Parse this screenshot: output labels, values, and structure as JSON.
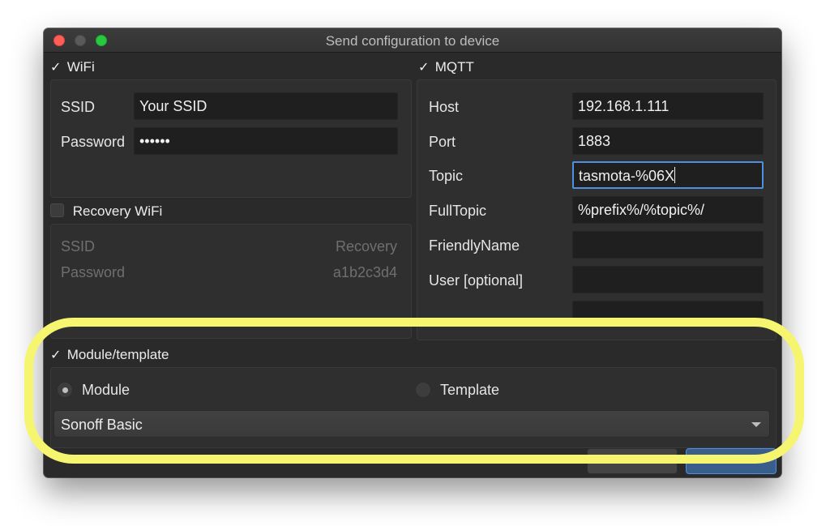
{
  "window": {
    "title": "Send configuration to device"
  },
  "wifi": {
    "header": "WiFi",
    "checked": true,
    "ssid_label": "SSID",
    "ssid_value": "Your SSID",
    "password_label": "Password",
    "password_value": "••••••"
  },
  "recovery_wifi": {
    "header": "Recovery WiFi",
    "checked": false,
    "ssid_label": "SSID",
    "ssid_value": "Recovery",
    "password_label": "Password",
    "password_value": "a1b2c3d4"
  },
  "mqtt": {
    "header": "MQTT",
    "checked": true,
    "host_label": "Host",
    "host_value": "192.168.1.111",
    "port_label": "Port",
    "port_value": "1883",
    "topic_label": "Topic",
    "topic_value": "tasmota-%06X",
    "fulltopic_label": "FullTopic",
    "fulltopic_value": "%prefix%/%topic%/",
    "friendlyname_label": "FriendlyName",
    "friendlyname_value": "",
    "user_label": "User [optional]",
    "user_value": ""
  },
  "module_template": {
    "header": "Module/template",
    "checked": true,
    "module_label": "Module",
    "template_label": "Template",
    "selected": "Module",
    "module_combo_value": "Sonoff Basic"
  },
  "colors": {
    "highlight": "#f6f570",
    "focus_ring": "#4e8fe0",
    "window_bg": "#2a2a2a"
  }
}
